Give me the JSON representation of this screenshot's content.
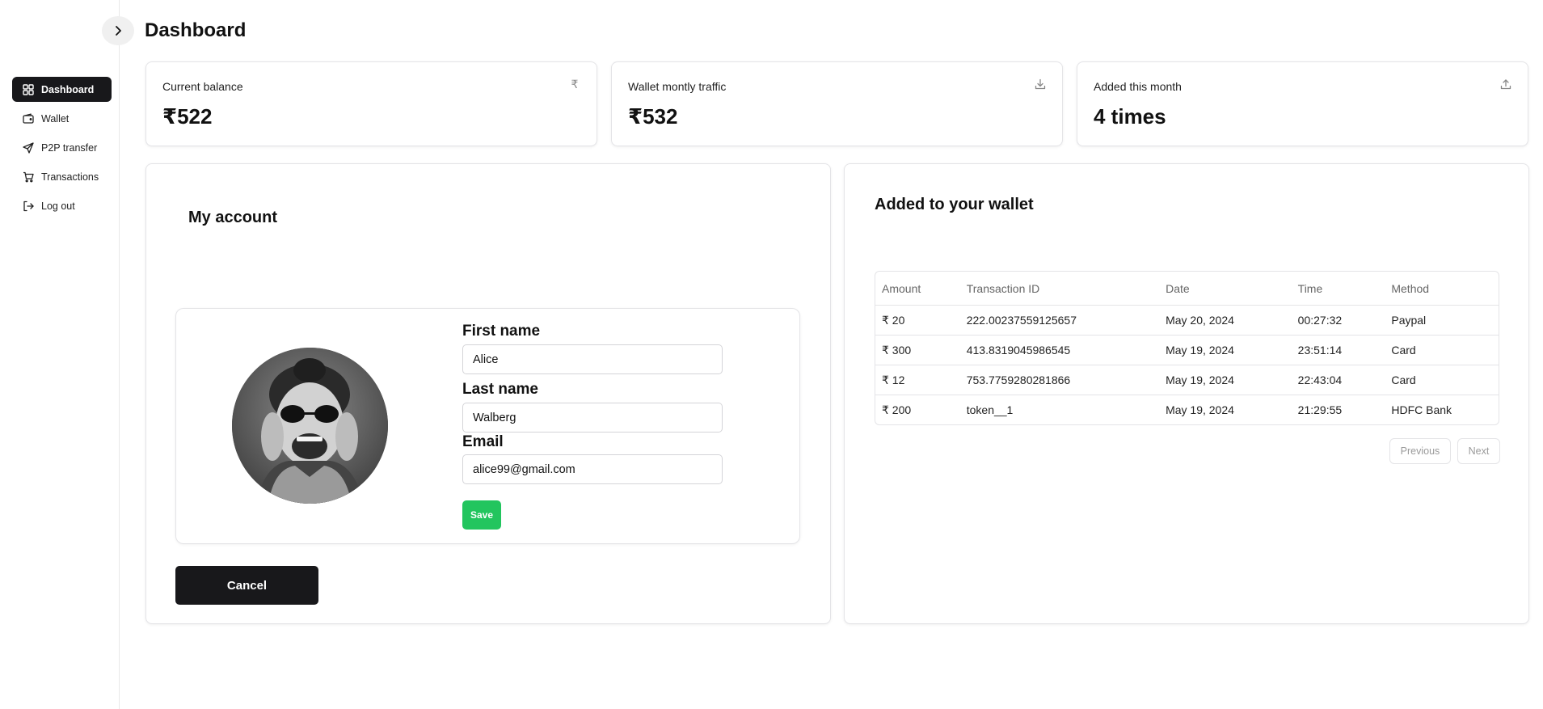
{
  "app": {
    "page_title": "Dashboard"
  },
  "sidebar": {
    "items": [
      {
        "label": "Dashboard",
        "icon": "dashboard-icon",
        "active": true
      },
      {
        "label": "Wallet",
        "icon": "wallet-icon",
        "active": false
      },
      {
        "label": "P2P transfer",
        "icon": "send-icon",
        "active": false
      },
      {
        "label": "Transactions",
        "icon": "cart-icon",
        "active": false
      },
      {
        "label": "Log out",
        "icon": "logout-icon",
        "active": false
      }
    ]
  },
  "stats": [
    {
      "label": "Current balance",
      "value": "₹522",
      "icon": "rupee-icon"
    },
    {
      "label": "Wallet montly traffic",
      "value": "₹532",
      "icon": "download-icon"
    },
    {
      "label": "Added this month",
      "value": "4 times",
      "icon": "upload-icon"
    }
  ],
  "account": {
    "title": "My account",
    "first_name_label": "First name",
    "first_name_value": "Alice",
    "last_name_label": "Last name",
    "last_name_value": "Walberg",
    "email_label": "Email",
    "email_value": "alice99@gmail.com",
    "save_label": "Save",
    "cancel_label": "Cancel"
  },
  "wallet": {
    "title": "Added to your wallet",
    "columns": [
      "Amount",
      "Transaction ID",
      "Date",
      "Time",
      "Method"
    ],
    "rows": [
      [
        "₹ 20",
        "222.00237559125657",
        "May 20, 2024",
        "00:27:32",
        "Paypal"
      ],
      [
        "₹ 300",
        "413.8319045986545",
        "May 19, 2024",
        "23:51:14",
        "Card"
      ],
      [
        "₹ 12",
        "753.7759280281866",
        "May 19, 2024",
        "22:43:04",
        "Card"
      ],
      [
        "₹ 200",
        "token__1",
        "May 19, 2024",
        "21:29:55",
        "HDFC Bank"
      ]
    ],
    "prev_label": "Previous",
    "next_label": "Next"
  },
  "colors": {
    "active_nav": "#18181b",
    "save_button": "#22c55e",
    "cancel_button": "#18181b",
    "border": "#e4e4e7"
  }
}
